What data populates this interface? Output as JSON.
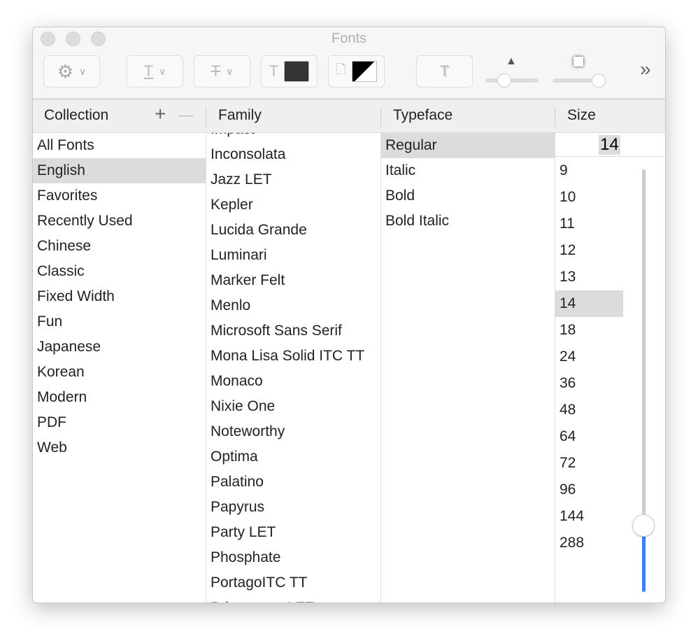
{
  "window": {
    "title": "Fonts"
  },
  "toolbar": {
    "more": "»",
    "text_color": "#333333"
  },
  "headers": {
    "collection": "Collection",
    "add": "+",
    "remove": "—",
    "family": "Family",
    "typeface": "Typeface",
    "size": "Size"
  },
  "collections": {
    "items": [
      "All Fonts",
      "English",
      "Favorites",
      "Recently Used",
      "Chinese",
      "Classic",
      "Fixed Width",
      "Fun",
      "Japanese",
      "Korean",
      "Modern",
      "PDF",
      "Web"
    ],
    "selected": "English"
  },
  "families": {
    "items": [
      "Impact",
      "Inconsolata",
      "Jazz LET",
      "Kepler",
      "Lucida Grande",
      "Luminari",
      "Marker Felt",
      "Menlo",
      "Microsoft Sans Serif",
      "Mona Lisa Solid ITC TT",
      "Monaco",
      "Nixie One",
      "Noteworthy",
      "Optima",
      "Palatino",
      "Papyrus",
      "Party LET",
      "Phosphate",
      "PortagoITC TT",
      "Princetown LET"
    ]
  },
  "typefaces": {
    "items": [
      "Regular",
      "Italic",
      "Bold",
      "Bold Italic"
    ],
    "selected": "Regular"
  },
  "size": {
    "value": "14",
    "items": [
      "9",
      "10",
      "11",
      "12",
      "13",
      "14",
      "18",
      "24",
      "36",
      "48",
      "64",
      "72",
      "96",
      "144",
      "288"
    ],
    "selected": "14",
    "slider_value": 14
  }
}
